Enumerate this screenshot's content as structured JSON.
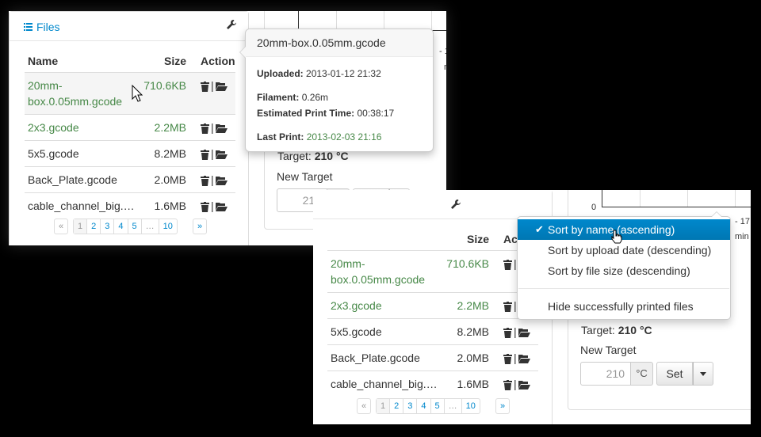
{
  "files_panel": {
    "title": "Files",
    "columns": {
      "name": "Name",
      "size": "Size",
      "action": "Action"
    },
    "rows": [
      {
        "name_line1": "20mm-",
        "name_line2": "box.0.05mm.gcode",
        "size": "710.6KB",
        "printed": true
      },
      {
        "name_line1": "2x3.gcode",
        "name_line2": "",
        "size": "2.2MB",
        "printed": true
      },
      {
        "name_line1": "5x5.gcode",
        "name_line2": "",
        "size": "8.2MB",
        "printed": false
      },
      {
        "name_line1": "Back_Plate.gcode",
        "name_line2": "",
        "size": "2.0MB",
        "printed": false
      },
      {
        "name_line1": "cable_channel_big.…",
        "name_line2": "",
        "size": "1.6MB",
        "printed": false
      }
    ],
    "separator": "|",
    "pagination": {
      "prev": "«",
      "pages": [
        "1",
        "2",
        "3",
        "4",
        "5",
        "…",
        "10"
      ],
      "next": "»",
      "active": "1"
    }
  },
  "popover": {
    "title": "20mm-box.0.05mm.gcode",
    "uploaded_label": "Uploaded:",
    "uploaded_value": "2013-01-12 21:32",
    "filament_label": "Filament:",
    "filament_value": "0.26m",
    "print_time_label": "Estimated Print Time:",
    "print_time_value": "00:38:17",
    "last_print_label": "Last Print:",
    "last_print_value": "2013-02-03 21:16"
  },
  "temperature": {
    "axis_zero": "0",
    "axis_tick": "- 17",
    "axis_unit": "min",
    "target_label": "Target:",
    "target_value": "210 °C",
    "new_target_label": "New Target",
    "input_value": "210",
    "unit": "°C",
    "set_label": "Set"
  },
  "sort_menu": {
    "items": [
      "Sort by name (ascending)",
      "Sort by upload date (descending)",
      "Sort by file size (descending)",
      "Hide successfully printed files"
    ],
    "selected_index": 0,
    "check": "✔"
  },
  "colors": {
    "link": "#0088cc",
    "printed": "#468847",
    "selected": "#0088cc"
  },
  "icons": [
    "list-icon",
    "wrench-icon",
    "trash-icon",
    "folder-open-icon",
    "check-icon",
    "caret-down-icon",
    "mouse-pointer-icon",
    "hand-pointer-icon"
  ]
}
